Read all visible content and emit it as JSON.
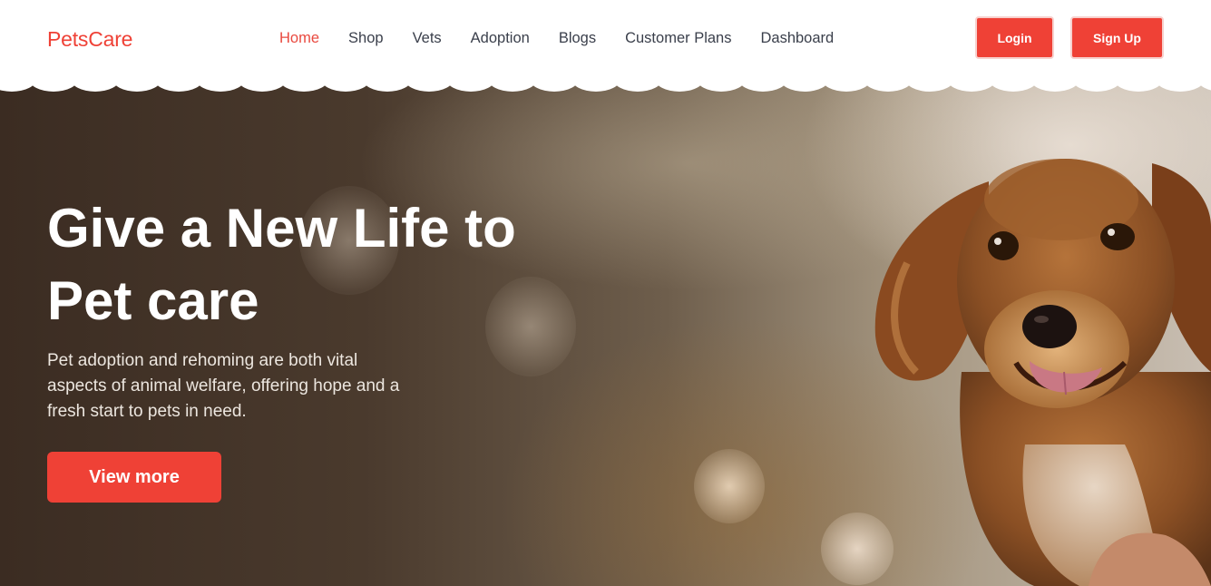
{
  "brand": {
    "name": "PetsCare",
    "accent": "#ef4136"
  },
  "nav": {
    "items": [
      {
        "label": "Home",
        "active": true
      },
      {
        "label": "Shop",
        "active": false
      },
      {
        "label": "Vets",
        "active": false
      },
      {
        "label": "Adoption",
        "active": false
      },
      {
        "label": "Blogs",
        "active": false
      },
      {
        "label": "Customer Plans",
        "active": false
      },
      {
        "label": "Dashboard",
        "active": false
      }
    ]
  },
  "auth": {
    "login_label": "Login",
    "signup_label": "Sign Up"
  },
  "hero": {
    "title_line1": "Give a New Life to",
    "title_line2": "Pet care",
    "description": "Pet adoption and rehoming are both vital aspects of animal welfare, offering hope and a fresh start to pets in need.",
    "cta_label": "View more",
    "image_subject": "puppy-photo"
  }
}
